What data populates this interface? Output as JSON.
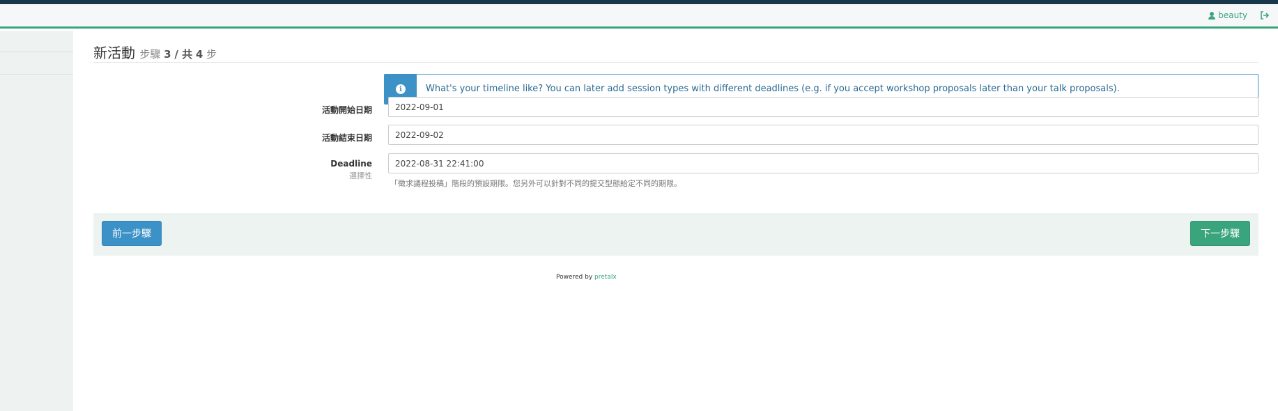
{
  "header": {
    "username": "beauty",
    "icons": [
      "user-icon",
      "logout-icon"
    ],
    "accent_color": "#3aa57c"
  },
  "page": {
    "title": "新活動",
    "step_prefix": "步驟",
    "step_current": "3",
    "step_sep": "/ 共",
    "step_total": "4",
    "step_suffix": "步"
  },
  "alert": {
    "icon": "info-icon",
    "text": "What's your timeline like? You can later add session types with different deadlines (e.g. if you accept workshop proposals later than your talk proposals).",
    "color": "#3c91c7"
  },
  "form": {
    "start_date": {
      "label": "活動開始日期",
      "value": "2022-09-01"
    },
    "end_date": {
      "label": "活動結束日期",
      "value": "2022-09-02"
    },
    "deadline": {
      "label": "Deadline",
      "optional": "選擇性",
      "value": "2022-08-31 22:41:00",
      "help": "「徵求議程投稿」階段的預設期限。您另外可以針對不同的提交型態給定不同的期限。"
    }
  },
  "buttons": {
    "prev": "前一步驟",
    "next": "下一步驟"
  },
  "footer": {
    "powered_by": "Powered by",
    "link": "pretalx"
  }
}
